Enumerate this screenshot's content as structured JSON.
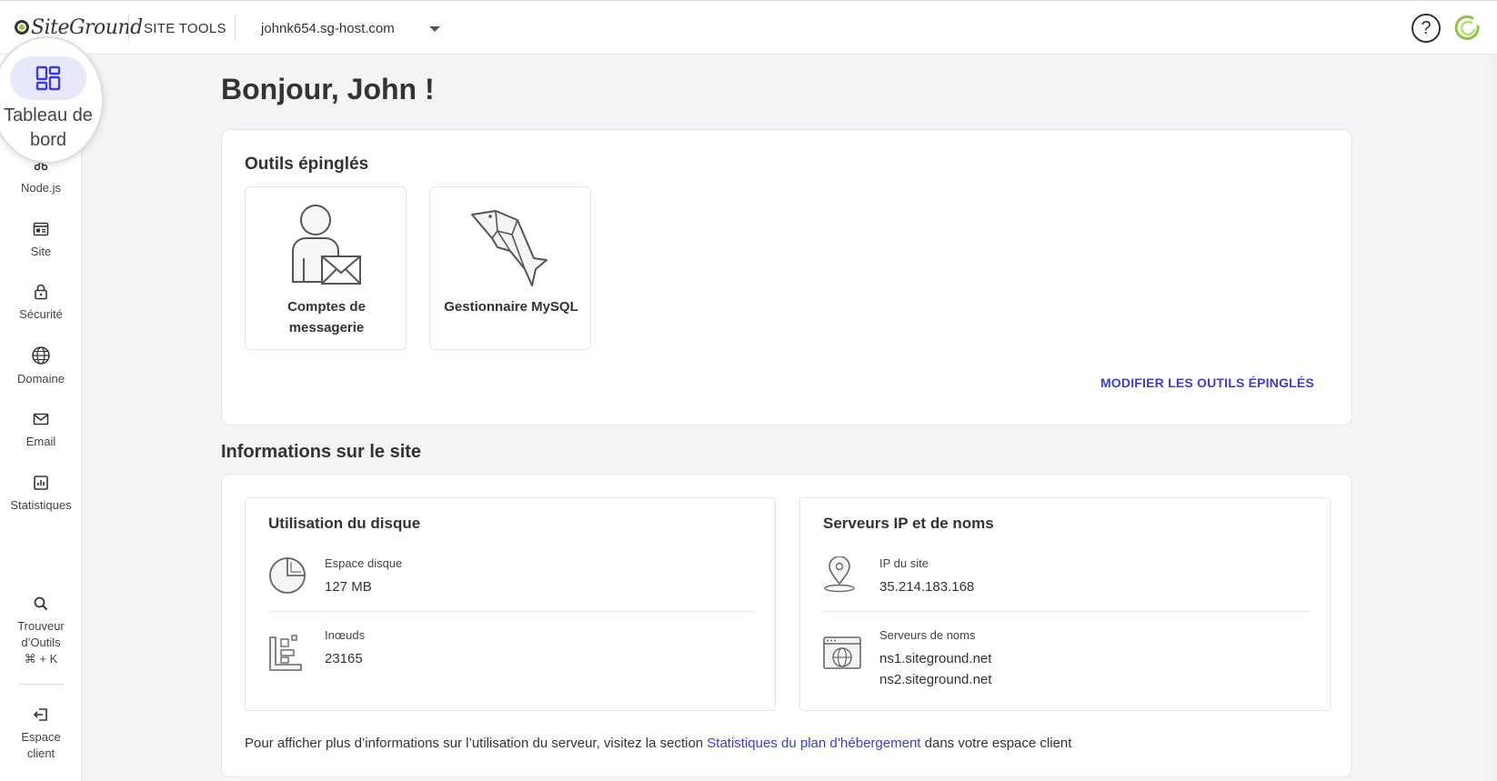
{
  "header": {
    "logo_text": "SiteGround",
    "site_tools": "SITE TOOLS",
    "domain": "johnk654.sg-host.com",
    "help": "?"
  },
  "sidebar": {
    "active": {
      "label": "Tableau de bord",
      "icon": "dashboard-icon"
    },
    "items": [
      {
        "label": "Node.js",
        "icon": "nodejs-icon"
      },
      {
        "label": "Site",
        "icon": "site-icon"
      },
      {
        "label": "Sécurité",
        "icon": "lock-icon"
      },
      {
        "label": "Domaine",
        "icon": "globe-icon"
      },
      {
        "label": "Email",
        "icon": "mail-icon"
      },
      {
        "label": "Statistiques",
        "icon": "stats-icon"
      }
    ],
    "tool_finder": {
      "line1": "Trouveur",
      "line2": "d’Outils",
      "line3": "⌘ + K",
      "icon": "search-icon"
    },
    "client_area": {
      "line1": "Espace",
      "line2": "client",
      "icon": "exit-icon"
    }
  },
  "main": {
    "greeting": "Bonjour, John !",
    "pinned": {
      "title": "Outils épinglés",
      "tools": [
        {
          "line1": "Comptes de",
          "line2": "messagerie",
          "icon": "email-accounts-icon"
        },
        {
          "line1": "Gestionnaire MySQL",
          "line2": "",
          "icon": "mysql-dolphin-icon"
        }
      ],
      "modify_label": "MODIFIER LES OUTILS ÉPINGLÉS"
    },
    "site_info": {
      "title": "Informations sur le site",
      "disk": {
        "title": "Utilisation du disque",
        "space_label": "Espace disque",
        "space_value": "127 MB",
        "inodes_label": "Inœuds",
        "inodes_value": "23165"
      },
      "servers": {
        "title": "Serveurs IP et de noms",
        "ip_label": "IP du site",
        "ip_value": "35.214.183.168",
        "ns_label": "Serveurs de noms",
        "ns1": "ns1.siteground.net",
        "ns2": "ns2.siteground.net"
      },
      "footnote_before": "Pour afficher plus d’informations sur l’utilisation du serveur, visitez la section ",
      "footnote_link": "Statistiques du plan d’hébergement",
      "footnote_after": " dans votre espace client"
    }
  },
  "colors": {
    "accent": "#3d3dcf",
    "active_pill": "#e8e8fb",
    "brand_green": "#8fc43c"
  }
}
